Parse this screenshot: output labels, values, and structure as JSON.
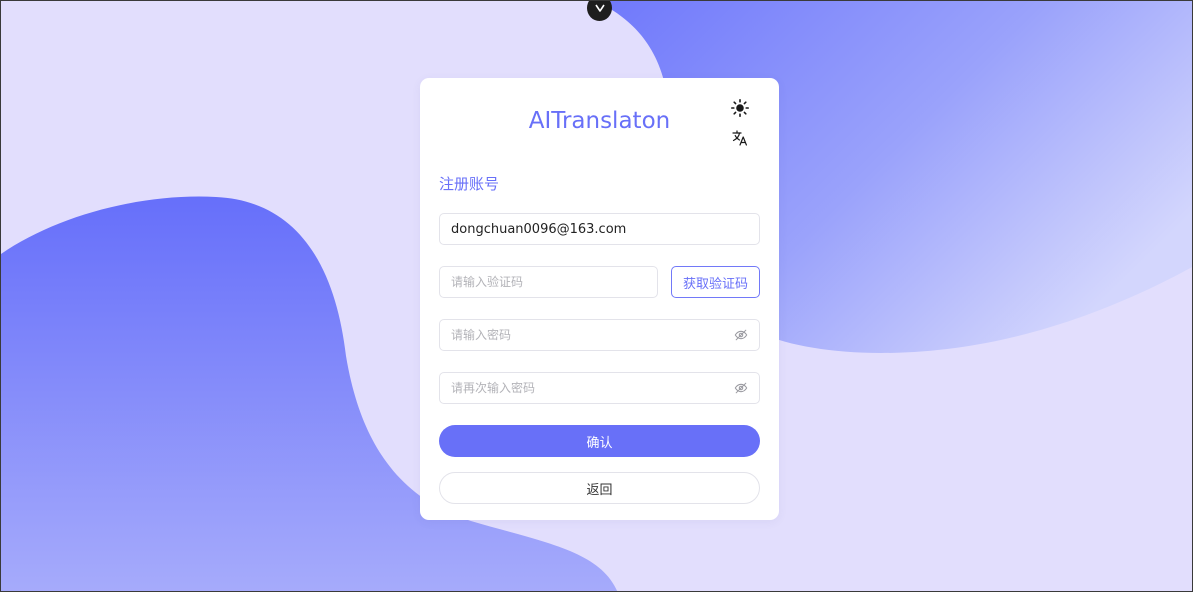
{
  "app": {
    "title": "AITranslaton"
  },
  "form": {
    "section_title": "注册账号",
    "email": {
      "value": "dongchuan0096@163.com",
      "placeholder": ""
    },
    "code": {
      "value": "",
      "placeholder": "请输入验证码"
    },
    "get_code_label": "获取验证码",
    "password": {
      "value": "",
      "placeholder": "请输入密码"
    },
    "password_confirm": {
      "value": "",
      "placeholder": "请再次输入密码"
    },
    "confirm_label": "确认",
    "back_label": "返回"
  },
  "icons": {
    "theme": "sun-icon",
    "language": "translate-icon",
    "password_visibility": "eye-off-icon",
    "top_handle": "chevron-down-icon"
  },
  "colors": {
    "accent": "#6870f8",
    "background": "#e2defd",
    "blob_light": "#a4abfb"
  }
}
